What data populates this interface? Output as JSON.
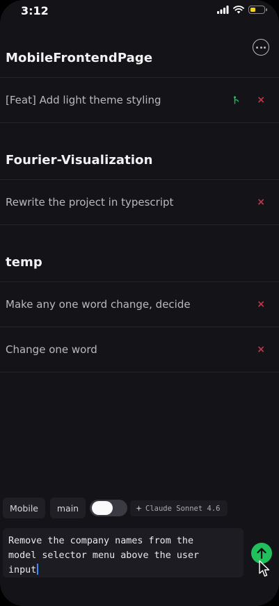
{
  "status": {
    "time": "3:12",
    "battery_color": "#f2d21b"
  },
  "header": {
    "more_icon": "more-horizontal-circle-icon"
  },
  "projects": [
    {
      "title": "MobileFrontendPage",
      "tasks": [
        {
          "label": "[Feat] Add light theme styling",
          "branch_icon": "branch-icon",
          "branch_color": "#23b559"
        }
      ]
    },
    {
      "title": "Fourier-Visualization",
      "tasks": [
        {
          "label": "Rewrite the project in typescript"
        }
      ]
    },
    {
      "title": "temp",
      "tasks": [
        {
          "label": "Make any one word change, decide"
        },
        {
          "label": "Change one word"
        }
      ]
    }
  ],
  "task_close_glyph": "×",
  "colors": {
    "close": "#c0384d",
    "send": "#20c15d",
    "background": "#141418"
  },
  "controls": {
    "platform_chip": "Mobile",
    "branch_chip": "main",
    "toggle_on": false,
    "model_label": "Claude Sonnet 4.6",
    "model_icon": "sparkle-icon"
  },
  "composer": {
    "text": "Remove the company names from the\nmodel selector menu above the user\ninput"
  }
}
